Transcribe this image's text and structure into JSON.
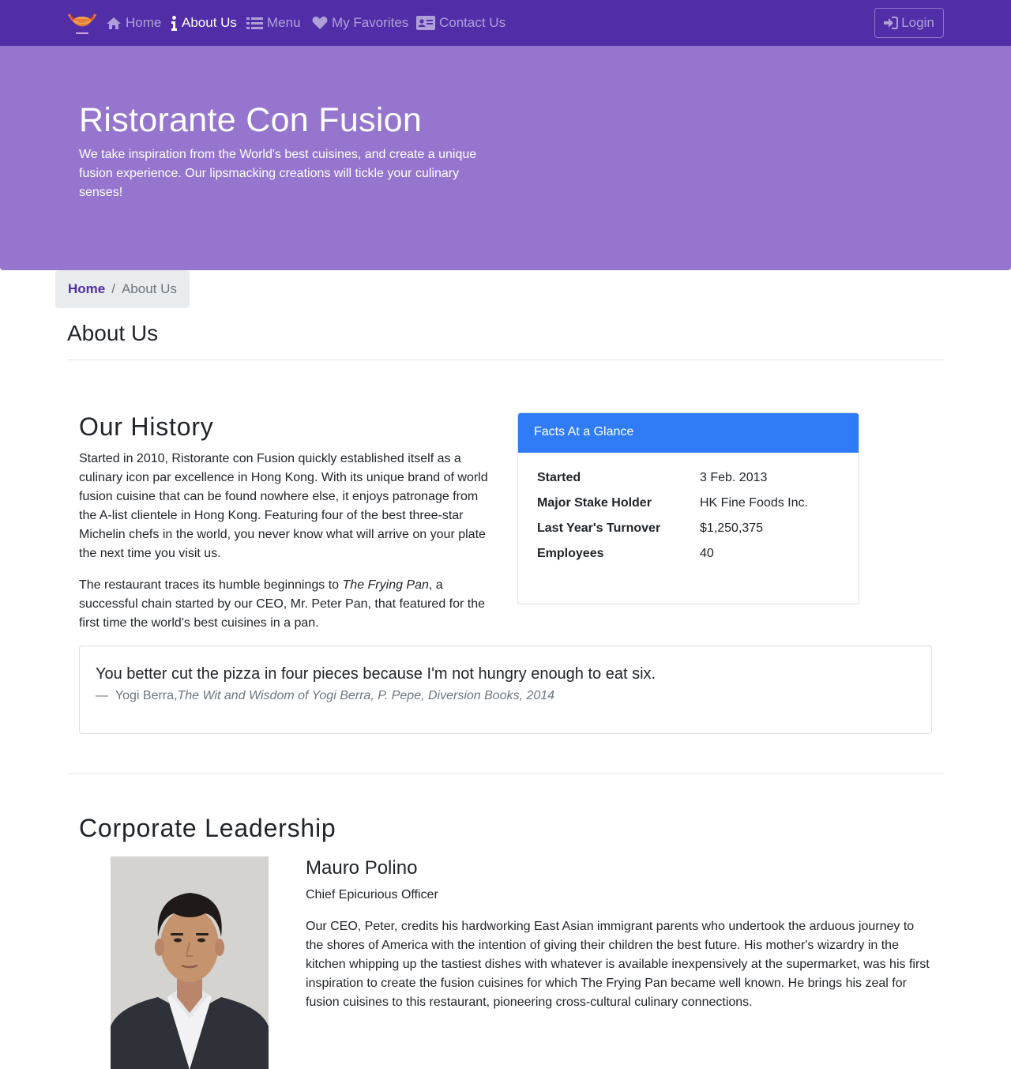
{
  "nav": {
    "brand_icon": "restaurant-logo",
    "items": [
      {
        "label": "Home",
        "icon": "home-icon"
      },
      {
        "label": "About Us",
        "icon": "info-icon",
        "active": true
      },
      {
        "label": "Menu",
        "icon": "list-icon"
      },
      {
        "label": "My Favorites",
        "icon": "heart-icon"
      },
      {
        "label": "Contact Us",
        "icon": "address-card-icon"
      }
    ],
    "login_label": "Login",
    "colors": {
      "bar": "#512da8"
    }
  },
  "jumbotron": {
    "title": "Ristorante Con Fusion",
    "text": "We take inspiration from the World's best cuisines, and create a unique fusion experience. Our lipsmacking creations will tickle your culinary senses!",
    "color": "#9575cd"
  },
  "breadcrumb": {
    "home": "Home",
    "separator": "/",
    "current": "About Us"
  },
  "page_title": "About Us",
  "history": {
    "heading": "Our History",
    "p1": "Started in 2010, Ristorante con Fusion quickly established itself as a culinary icon par excellence in Hong Kong. With its unique brand of world fusion cuisine that can be found nowhere else, it enjoys patronage from the A-list clientele in Hong Kong. Featuring four of the best three-star Michelin chefs in the world, you never know what will arrive on your plate the next time you visit us.",
    "p2_before": "The restaurant traces its humble beginnings to ",
    "p2_em": "The Frying Pan",
    "p2_after": ", a successful chain started by our CEO, Mr. Peter Pan, that featured for the first time the world's best cuisines in a pan."
  },
  "facts": {
    "header": "Facts At a Glance",
    "header_color": "#2f7cf6",
    "rows": [
      {
        "label": "Started",
        "value": "3 Feb. 2013"
      },
      {
        "label": "Major Stake Holder",
        "value": "HK Fine Foods Inc."
      },
      {
        "label": "Last Year's Turnover",
        "value": "$1,250,375"
      },
      {
        "label": "Employees",
        "value": "40"
      }
    ]
  },
  "quote": {
    "text": "You better cut the pizza in four pieces because I'm not hungry enough to eat six.",
    "dash": "—",
    "author": "Yogi Berra,",
    "source": "The Wit and Wisdom of Yogi Berra, P. Pepe, Diversion Books, 2014"
  },
  "leadership": {
    "heading": "Corporate Leadership",
    "leaders": [
      {
        "name": "Mauro Polino",
        "designation": "Chief Epicurious Officer",
        "bio": "Our CEO, Peter, credits his hardworking East Asian immigrant parents who undertook the arduous journey to the shores of America with the intention of giving their children the best future. His mother's wizardry in the kitchen whipping up the tastiest dishes with whatever is available inexpensively at the supermarket, was his first inspiration to create the fusion cuisines for which The Frying Pan became well known. He brings his zeal for fusion cuisines to this restaurant, pioneering cross-cultural culinary connections.",
        "image": "leader-photo"
      }
    ]
  }
}
